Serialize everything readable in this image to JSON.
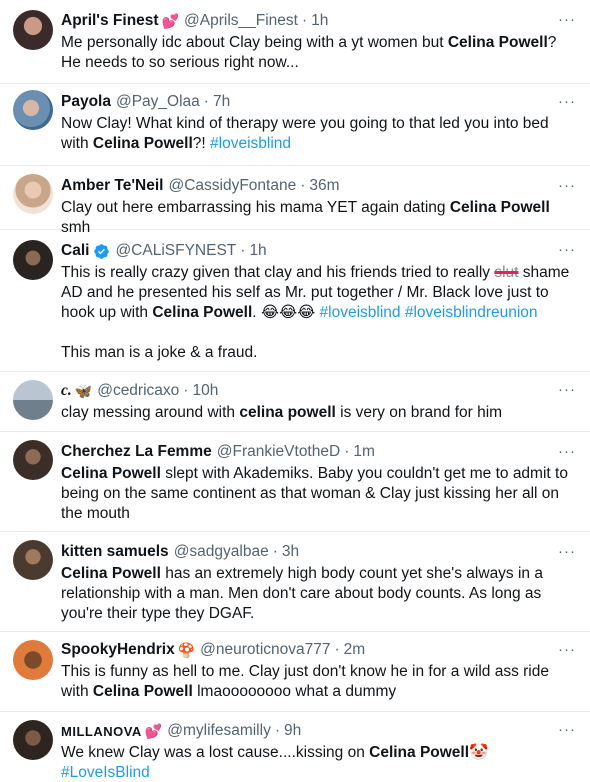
{
  "tweets": [
    {
      "name": "April's Finest",
      "emoji": "💕",
      "handle": "@Aprils__Finest",
      "time": "1h",
      "parts": [
        {
          "t": "Me personally idc about Clay being with a yt women but "
        },
        {
          "b": "Celina Powell"
        },
        {
          "t": "? He needs to so serious right now..."
        }
      ],
      "avatar_color": "#3a2a2a"
    },
    {
      "name": "Payola",
      "handle": "@Pay_Olaa",
      "time": "7h",
      "parts": [
        {
          "t": "Now Clay! What kind of therapy were you going to that led you into bed with "
        },
        {
          "b": "Celina Powell"
        },
        {
          "t": "?! "
        },
        {
          "h": "#loveisblind"
        }
      ],
      "avatar_color": "#6a8fb0"
    },
    {
      "name": "Amber Te'Neil",
      "handle": "@CassidyFontane",
      "time": "36m",
      "parts": [
        {
          "t": "Clay out here embarrassing his mama YET again dating "
        },
        {
          "b": "Celina Powell"
        },
        {
          "t": " smh"
        }
      ],
      "avatar_color": "#c9a58a"
    },
    {
      "name": "Cali",
      "verified": true,
      "handle": "@CALiSFYNEST",
      "time": "1h",
      "parts": [
        {
          "t": "This is really crazy given that clay and his friends tried to really "
        },
        {
          "s": "slut"
        },
        {
          "t": " shame AD and he presented his self as Mr. put together / Mr. Black love just to hook up with "
        },
        {
          "b": "Celina Powell"
        },
        {
          "t": ". 😂😂😂 "
        },
        {
          "h": "#loveisblind"
        },
        {
          "t": " "
        },
        {
          "h": "#loveisblindreunion"
        }
      ],
      "second_para": "This man is a joke & a fraud.",
      "avatar_color": "#2a2420"
    },
    {
      "name": "c.",
      "emoji": "🦋",
      "handle": "@cedricaxo",
      "time": "10h",
      "parts": [
        {
          "t": "clay messing around with "
        },
        {
          "b": "celina powell"
        },
        {
          "t": " is very on brand for him"
        }
      ],
      "avatar_color": "#8a9aa8"
    },
    {
      "name": "Cherchez La Femme",
      "handle": "@FrankieVtotheD",
      "time": "1m",
      "parts": [
        {
          "b": "Celina Powell"
        },
        {
          "t": " slept with Akademiks. Baby you couldn't get me to admit to being on the same continent as that woman & Clay just kissing her all on the mouth"
        }
      ],
      "avatar_color": "#3b2e28"
    },
    {
      "name": "kitten samuels",
      "handle": "@sadgyalbae",
      "time": "3h",
      "parts": [
        {
          "b": "Celina Powell"
        },
        {
          "t": " has an extremely high body count yet she's always in a relationship with a man. Men don't care about body counts. As long as you're their type they DGAF."
        }
      ],
      "avatar_color": "#4a3a30"
    },
    {
      "name": "SpookyHendrix",
      "emoji": "🍄",
      "handle": "@neuroticnova777",
      "time": "2m",
      "parts": [
        {
          "t": "This is funny as hell to me. Clay just don't know he in for a wild ass ride with "
        },
        {
          "b": "Celina Powell"
        },
        {
          "t": " lmaoooooooo what a dummy"
        }
      ],
      "avatar_color": "#e07b3c"
    },
    {
      "name": "MILLANOVA",
      "emoji": "💕",
      "handle": "@mylifesamilly",
      "time": "9h",
      "parts": [
        {
          "t": "We knew Clay was a lost cause....kissing on "
        },
        {
          "b": "Celina Powell"
        },
        {
          "t": "🤡 "
        },
        {
          "h": "#LoveIsBlind"
        }
      ],
      "avatar_color": "#2e2420"
    }
  ],
  "more_icon": "···"
}
